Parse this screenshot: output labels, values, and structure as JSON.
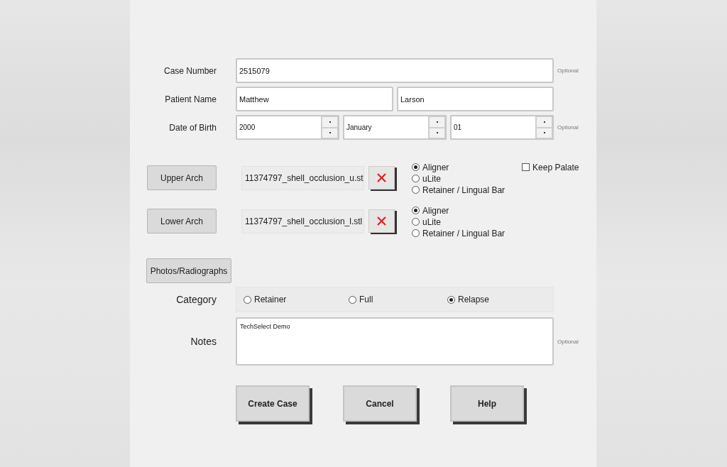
{
  "case_number": {
    "label": "Case Number",
    "value": "2515079",
    "note": "Optional"
  },
  "patient_name": {
    "label": "Patient Name",
    "first": "Matthew",
    "last": "Larson"
  },
  "date_of_birth": {
    "label": "Date of Birth",
    "year": "2000",
    "month": "January",
    "day": "01",
    "note": "Optional"
  },
  "arches": [
    {
      "button": "Upper Arch",
      "file": "11374797_shell_occlusion_u.st",
      "options": [
        {
          "label": "Aligner",
          "selected": true
        },
        {
          "label": "uLite",
          "selected": false
        },
        {
          "label": "Retainer / Lingual Bar",
          "selected": false
        }
      ],
      "keep_palate": {
        "label": "Keep Palate",
        "checked": false
      }
    },
    {
      "button": "Lower Arch",
      "file": "11374797_shell_occlusion_l.stl",
      "options": [
        {
          "label": "Aligner",
          "selected": true
        },
        {
          "label": "uLite",
          "selected": false
        },
        {
          "label": "Retainer / Lingual Bar",
          "selected": false
        }
      ]
    }
  ],
  "photos_button": "Photos/Radiographs",
  "category": {
    "label": "Category",
    "options": [
      {
        "label": "Retainer",
        "selected": false
      },
      {
        "label": "Full",
        "selected": false
      },
      {
        "label": "Relapse",
        "selected": true
      }
    ]
  },
  "notes": {
    "label": "Notes",
    "value": "TechSelect Demo",
    "note": "Optional"
  },
  "actions": [
    "Create Case",
    "Cancel",
    "Help"
  ]
}
